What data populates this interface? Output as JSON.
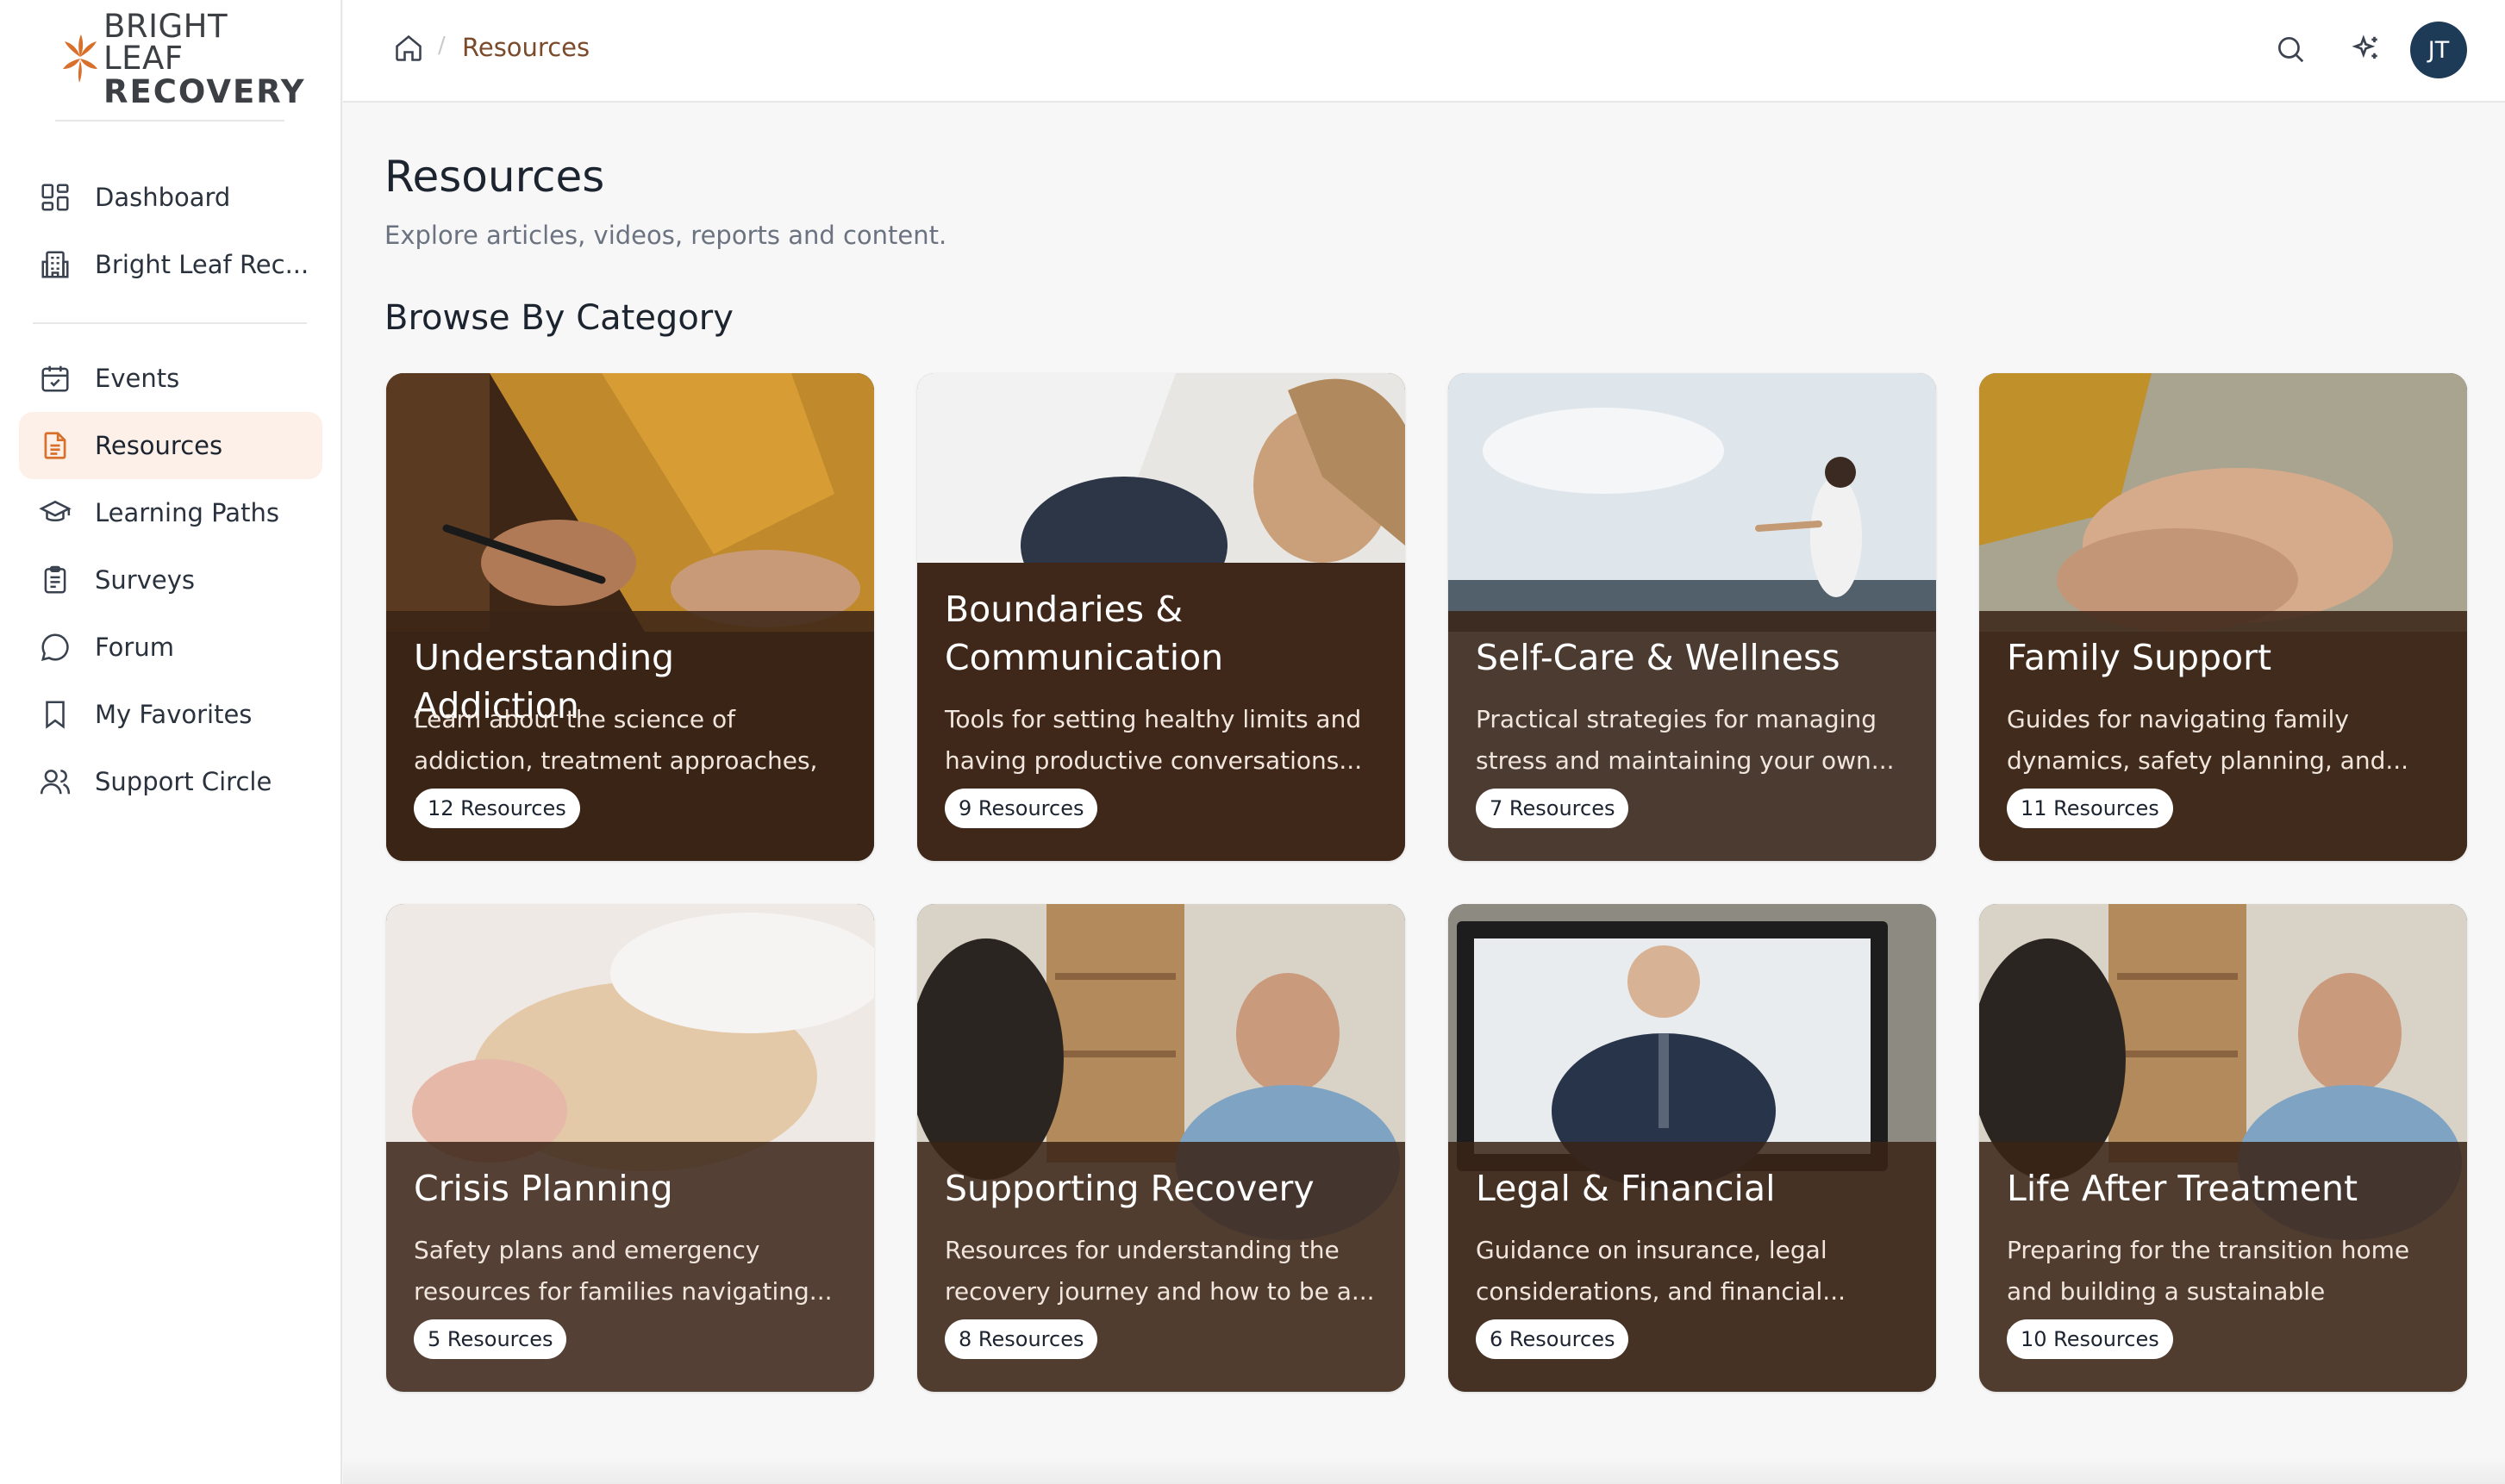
{
  "brand": {
    "line1": "BRIGHT LEAF",
    "line2": "RECOVERY",
    "accent_color": "#d8702c"
  },
  "sidebar": {
    "group1": [
      {
        "label": "Dashboard",
        "icon": "grid-icon"
      },
      {
        "label": "Bright Leaf Rec...",
        "icon": "building-icon"
      }
    ],
    "group2": [
      {
        "label": "Events",
        "icon": "calendar-check-icon"
      },
      {
        "label": "Resources",
        "icon": "document-icon",
        "active": true
      },
      {
        "label": "Learning Paths",
        "icon": "graduation-cap-icon"
      },
      {
        "label": "Surveys",
        "icon": "clipboard-icon"
      },
      {
        "label": "Forum",
        "icon": "chat-bubble-icon"
      },
      {
        "label": "My Favorites",
        "icon": "bookmark-icon"
      },
      {
        "label": "Support Circle",
        "icon": "users-icon"
      }
    ]
  },
  "header": {
    "breadcrumb": "Resources",
    "avatar_initials": "JT",
    "avatar_color": "#1d3a57"
  },
  "main": {
    "title": "Resources",
    "subtitle": "Explore articles, videos, reports and content.",
    "section_title": "Browse By Category",
    "categories": [
      {
        "title": "Understanding Addiction",
        "description": "Learn about the science of addiction, treatment approaches, and what...",
        "count": "12 Resources"
      },
      {
        "title": "Boundaries & Communication",
        "description": "Tools for setting healthy limits and having productive conversations...",
        "count": "9 Resources"
      },
      {
        "title": "Self-Care & Wellness",
        "description": "Practical strategies for managing stress and maintaining your own...",
        "count": "7 Resources"
      },
      {
        "title": "Family Support",
        "description": "Guides for navigating family dynamics, safety planning, and...",
        "count": "11 Resources"
      },
      {
        "title": "Crisis Planning",
        "description": "Safety plans and emergency resources for families navigating...",
        "count": "5 Resources"
      },
      {
        "title": "Supporting Recovery",
        "description": "Resources for understanding the recovery journey and how to be a...",
        "count": "8 Resources"
      },
      {
        "title": "Legal & Financial",
        "description": "Guidance on insurance, legal considerations, and financial...",
        "count": "6 Resources"
      },
      {
        "title": "Life After Treatment",
        "description": "Preparing for the transition home and building a sustainable support...",
        "count": "10 Resources"
      }
    ]
  }
}
